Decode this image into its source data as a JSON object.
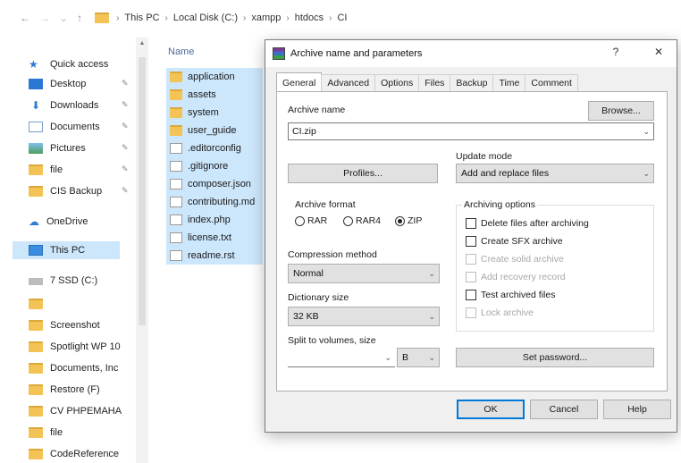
{
  "address": {
    "crumbs": [
      "This PC",
      "Local Disk (C:)",
      "xampp",
      "htdocs",
      "CI"
    ]
  },
  "nav": {
    "items": [
      {
        "label": "Quick access",
        "icon": "star-icon"
      },
      {
        "label": "Desktop",
        "icon": "desktop-icon"
      },
      {
        "label": "Downloads",
        "icon": "download-icon"
      },
      {
        "label": "Documents",
        "icon": "documents-icon"
      },
      {
        "label": "Pictures",
        "icon": "pictures-icon"
      },
      {
        "label": "file",
        "icon": "folder-icon"
      },
      {
        "label": "CIS Backup",
        "icon": "folder-icon"
      },
      {
        "label": "OneDrive",
        "icon": "cloud-icon"
      },
      {
        "label": "This PC",
        "icon": "computer-icon"
      },
      {
        "label": "7 SSD (C:)",
        "icon": "drive-icon"
      },
      {
        "label": "",
        "icon": "folder-icon"
      },
      {
        "label": "Screenshot",
        "icon": "folder-icon"
      },
      {
        "label": "Spotlight WP 10",
        "icon": "folder-icon"
      },
      {
        "label": "Documents, Inc",
        "icon": "folder-icon"
      },
      {
        "label": "Restore (F)",
        "icon": "folder-icon"
      },
      {
        "label": "CV PHPEMAHA",
        "icon": "folder-icon"
      },
      {
        "label": "file",
        "icon": "folder-icon"
      },
      {
        "label": "CodeReference",
        "icon": "folder-icon"
      }
    ]
  },
  "files": {
    "header": "Name",
    "items": [
      {
        "name": "application",
        "type": "folder"
      },
      {
        "name": "assets",
        "type": "folder"
      },
      {
        "name": "system",
        "type": "folder"
      },
      {
        "name": "user_guide",
        "type": "folder"
      },
      {
        "name": ".editorconfig",
        "type": "file"
      },
      {
        "name": ".gitignore",
        "type": "file"
      },
      {
        "name": "composer.json",
        "type": "file"
      },
      {
        "name": "contributing.md",
        "type": "file"
      },
      {
        "name": "index.php",
        "type": "file"
      },
      {
        "name": "license.txt",
        "type": "file"
      },
      {
        "name": "readme.rst",
        "type": "file"
      }
    ]
  },
  "dialog": {
    "title": "Archive name and parameters",
    "help_btn": "?",
    "close_btn": "✕",
    "tabs": [
      "General",
      "Advanced",
      "Options",
      "Files",
      "Backup",
      "Time",
      "Comment"
    ],
    "active_tab": 0,
    "archive_name_label": "Archive name",
    "archive_name_value": "CI.zip",
    "browse_label": "Browse...",
    "update_mode_label": "Update mode",
    "update_mode_value": "Add and replace files",
    "profiles_label": "Profiles...",
    "archive_format_label": "Archive format",
    "formats": [
      {
        "label": "RAR",
        "selected": false
      },
      {
        "label": "RAR4",
        "selected": false
      },
      {
        "label": "ZIP",
        "selected": true
      }
    ],
    "compression_label": "Compression method",
    "compression_value": "Normal",
    "dictionary_label": "Dictionary size",
    "dictionary_value": "32 KB",
    "split_label": "Split to volumes, size",
    "split_unit": "B",
    "archiving_options_label": "Archiving options",
    "options": [
      {
        "label": "Delete files after archiving",
        "enabled": true
      },
      {
        "label": "Create SFX archive",
        "enabled": true
      },
      {
        "label": "Create solid archive",
        "enabled": false
      },
      {
        "label": "Add recovery record",
        "enabled": false
      },
      {
        "label": "Test archived files",
        "enabled": true
      },
      {
        "label": "Lock archive",
        "enabled": false
      }
    ],
    "set_password_label": "Set password...",
    "ok_label": "OK",
    "cancel_label": "Cancel",
    "help_label": "Help"
  }
}
